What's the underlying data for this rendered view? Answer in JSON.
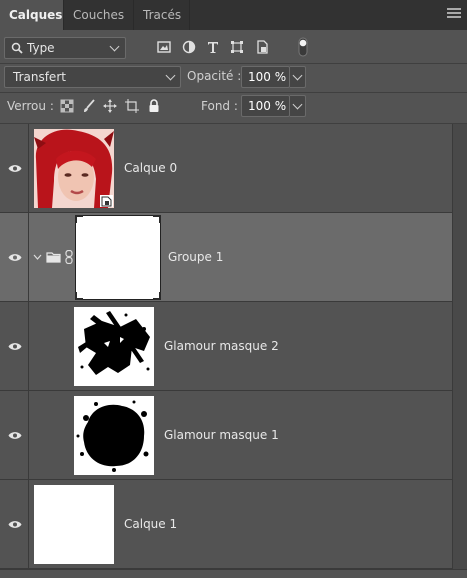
{
  "tabs": [
    {
      "label": "Calques",
      "active": true
    },
    {
      "label": "Couches",
      "active": false
    },
    {
      "label": "Tracés",
      "active": false
    }
  ],
  "filter": {
    "selected": "Type"
  },
  "blend": {
    "mode": "Transfert",
    "opacity_label": "Opacité :",
    "opacity_value": "100 %"
  },
  "lock": {
    "label": "Verrou :",
    "fill_label": "Fond :",
    "fill_value": "100 %"
  },
  "layers": [
    {
      "name": "Calque 0",
      "thumb": "portrait-photo",
      "selected": false
    },
    {
      "name": "Groupe 1",
      "thumb": "group-white-mask",
      "selected": true
    },
    {
      "name": "Glamour masque 2",
      "thumb": "brush-splatter-mask",
      "selected": false
    },
    {
      "name": "Glamour masque 1",
      "thumb": "blot-mask",
      "selected": false
    },
    {
      "name": "Calque 1",
      "thumb": "white-fill",
      "selected": false
    }
  ],
  "colors": {
    "panel_bg": "#535353",
    "tabbar_bg": "#323232",
    "selected_row": "#6b6b6b"
  }
}
